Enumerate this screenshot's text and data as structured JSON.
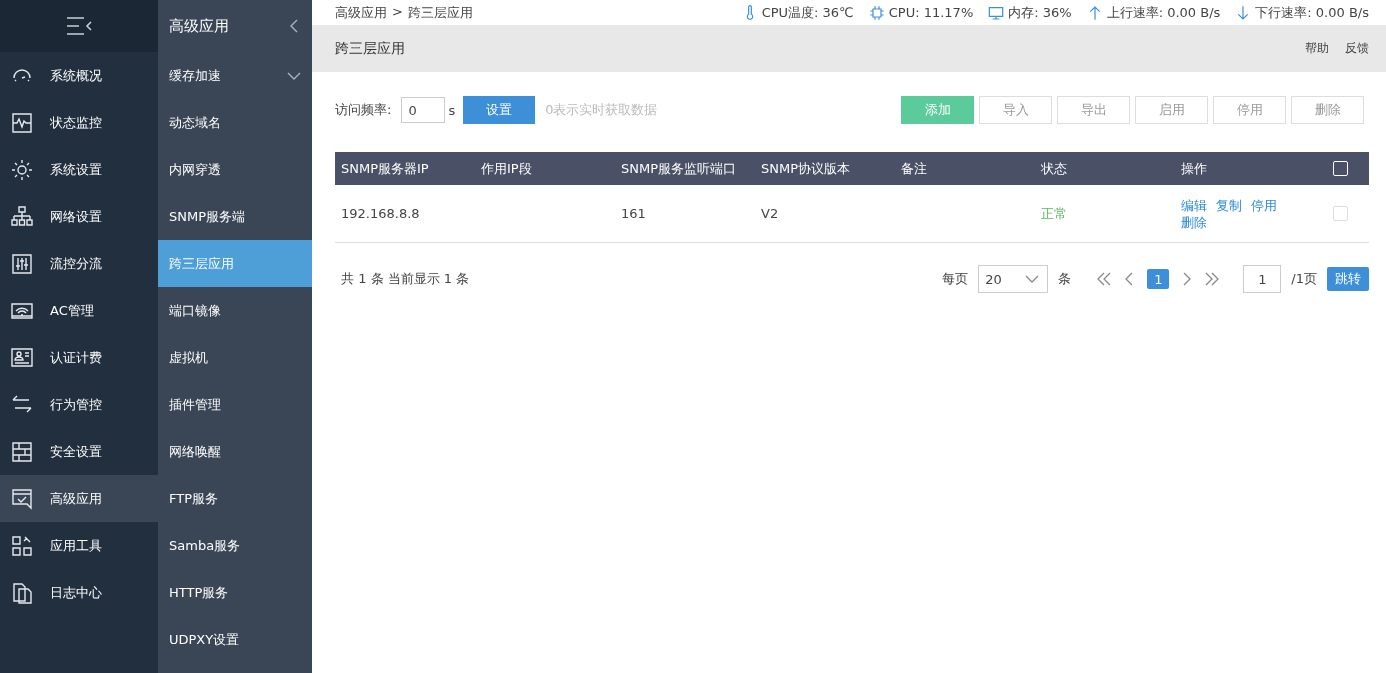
{
  "nav": {
    "items": [
      {
        "label": "系统概况",
        "selected": false
      },
      {
        "label": "状态监控",
        "selected": false
      },
      {
        "label": "系统设置",
        "selected": false
      },
      {
        "label": "网络设置",
        "selected": false
      },
      {
        "label": "流控分流",
        "selected": false
      },
      {
        "label": "AC管理",
        "selected": false
      },
      {
        "label": "认证计费",
        "selected": false
      },
      {
        "label": "行为管控",
        "selected": false
      },
      {
        "label": "安全设置",
        "selected": false
      },
      {
        "label": "高级应用",
        "selected": true
      },
      {
        "label": "应用工具",
        "selected": false
      },
      {
        "label": "日志中心",
        "selected": false
      }
    ]
  },
  "submenu": {
    "title": "高级应用",
    "items": [
      {
        "label": "缓存加速",
        "kind": "group",
        "expanded": false,
        "selected": false
      },
      {
        "label": "动态域名",
        "kind": "link",
        "selected": false
      },
      {
        "label": "内网穿透",
        "kind": "link",
        "selected": false
      },
      {
        "label": "SNMP服务端",
        "kind": "link",
        "selected": false
      },
      {
        "label": "跨三层应用",
        "kind": "link",
        "selected": true
      },
      {
        "label": "端口镜像",
        "kind": "link",
        "selected": false
      },
      {
        "label": "虚拟机",
        "kind": "link",
        "selected": false
      },
      {
        "label": "插件管理",
        "kind": "link",
        "selected": false
      },
      {
        "label": "网络唤醒",
        "kind": "link",
        "selected": false
      },
      {
        "label": "FTP服务",
        "kind": "link",
        "selected": false
      },
      {
        "label": "Samba服务",
        "kind": "link",
        "selected": false
      },
      {
        "label": "HTTP服务",
        "kind": "link",
        "selected": false
      },
      {
        "label": "UDPXY设置",
        "kind": "link",
        "selected": false
      }
    ]
  },
  "breadcrumb": [
    "高级应用",
    "跨三层应用"
  ],
  "breadcrumb_separator": ">",
  "status_bar": [
    {
      "kind": "temp",
      "text": "CPU温度: 36℃"
    },
    {
      "kind": "cpu",
      "text": "CPU: 11.17%"
    },
    {
      "kind": "memory",
      "text": "内存: 36%"
    },
    {
      "kind": "up",
      "text": "上行速率: 0.00 B/s"
    },
    {
      "kind": "down",
      "text": "下行速率: 0.00 B/s"
    }
  ],
  "page": {
    "title": "跨三层应用",
    "links": [
      "帮助",
      "反馈"
    ]
  },
  "toolbar": {
    "frequency_label": "访问频率:",
    "frequency_value": "0",
    "unit": "s",
    "set_button": "设置",
    "hint": "0表示实时获取数据",
    "buttons": [
      {
        "label": "添加",
        "kind": "primary"
      },
      {
        "label": "导入",
        "kind": "plain"
      },
      {
        "label": "导出",
        "kind": "plain"
      },
      {
        "label": "启用",
        "kind": "plain"
      },
      {
        "label": "停用",
        "kind": "plain"
      },
      {
        "label": "删除",
        "kind": "plain"
      }
    ]
  },
  "table": {
    "columns": [
      "SNMP服务器IP",
      "作用IP段",
      "SNMP服务监听端口",
      "SNMP协议版本",
      "备注",
      "状态",
      "操作"
    ],
    "select_all_checked": false,
    "rows": [
      {
        "cells": [
          "192.168.8.8",
          "",
          "161",
          "V2",
          ""
        ],
        "status": {
          "text": "正常",
          "color": "#5cb85c"
        },
        "actions": [
          "编辑",
          "复制",
          "停用",
          "删除"
        ],
        "checked": false
      }
    ]
  },
  "pagination": {
    "summary": "共 1 条 当前显示 1 条",
    "per_page_label": "每页",
    "per_page": "20",
    "per_page_unit": "条",
    "pages": [
      {
        "label": "1",
        "selected": true
      }
    ],
    "jump_value": "1",
    "total_pages": "/1页",
    "jump_button": "跳转"
  }
}
